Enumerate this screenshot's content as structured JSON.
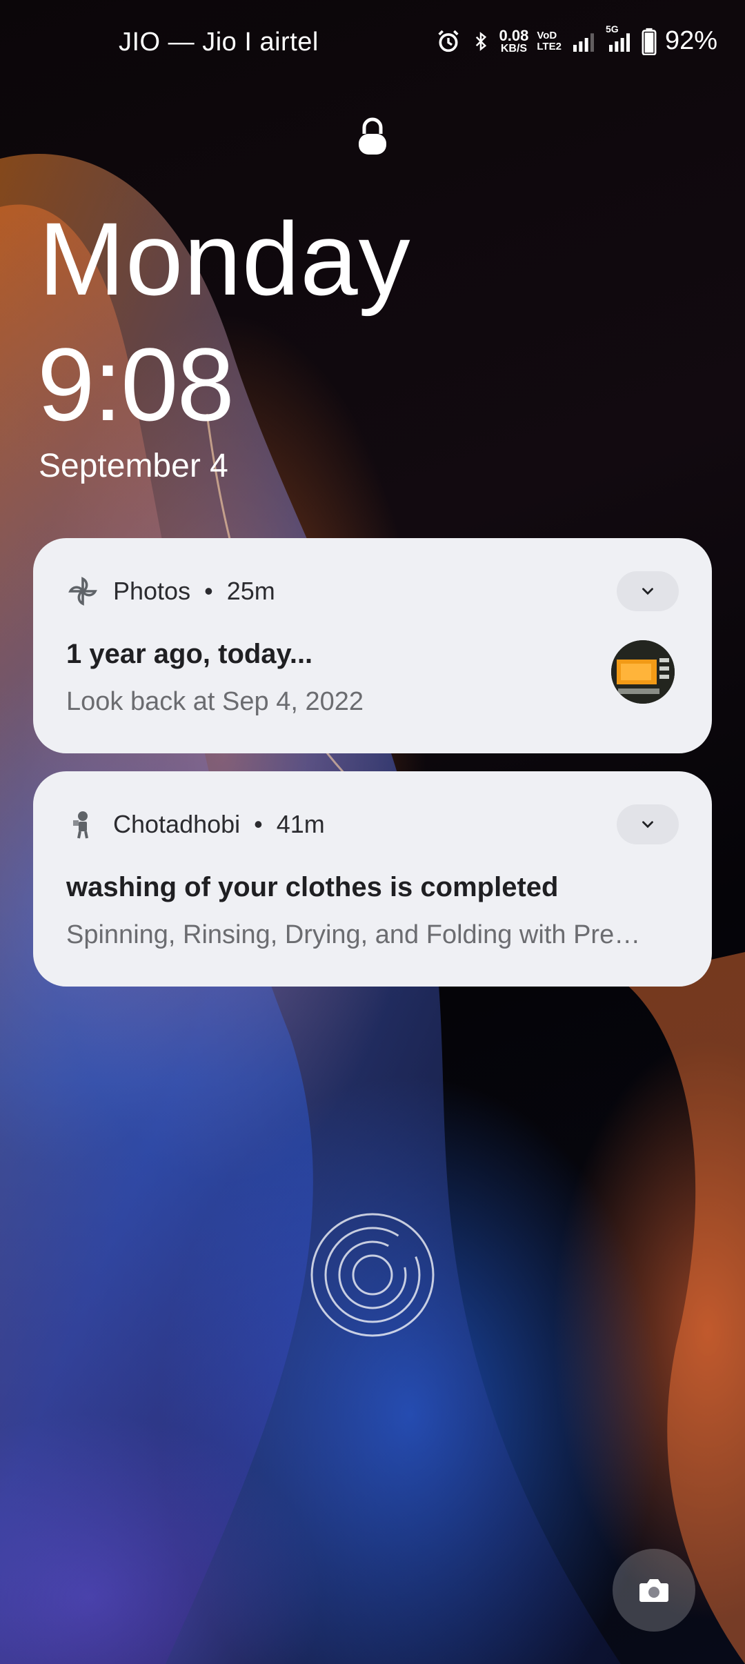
{
  "status_bar": {
    "carrier": "JIO — Jio I airtel",
    "net_speed_value": "0.08",
    "net_speed_unit": "KB/S",
    "volte_top": "VoD",
    "volte_bottom": "LTE2",
    "network_type": "5G",
    "battery_percent": "92%",
    "icons": [
      "alarm-icon",
      "bluetooth-icon",
      "signal-icon",
      "signal-5g-icon",
      "battery-icon"
    ]
  },
  "lockscreen": {
    "day": "Monday",
    "time": "9:08",
    "date": "September 4"
  },
  "notifications": [
    {
      "app": "Photos",
      "age": "25m",
      "title": "1 year ago, today...",
      "body": "Look back at Sep 4, 2022",
      "icon": "pinwheel-icon"
    },
    {
      "app": "Chotadhobi",
      "age": "41m",
      "title": "washing of your clothes is completed",
      "body": "Spinning, Rinsing, Drying, and Folding with Pre…",
      "icon": "washer-mascot-icon"
    }
  ],
  "separator": "•",
  "colors": {
    "card_bg": "#eff0f4",
    "expand_bg": "#e2e3e8",
    "text_secondary": "#6b6c70"
  }
}
